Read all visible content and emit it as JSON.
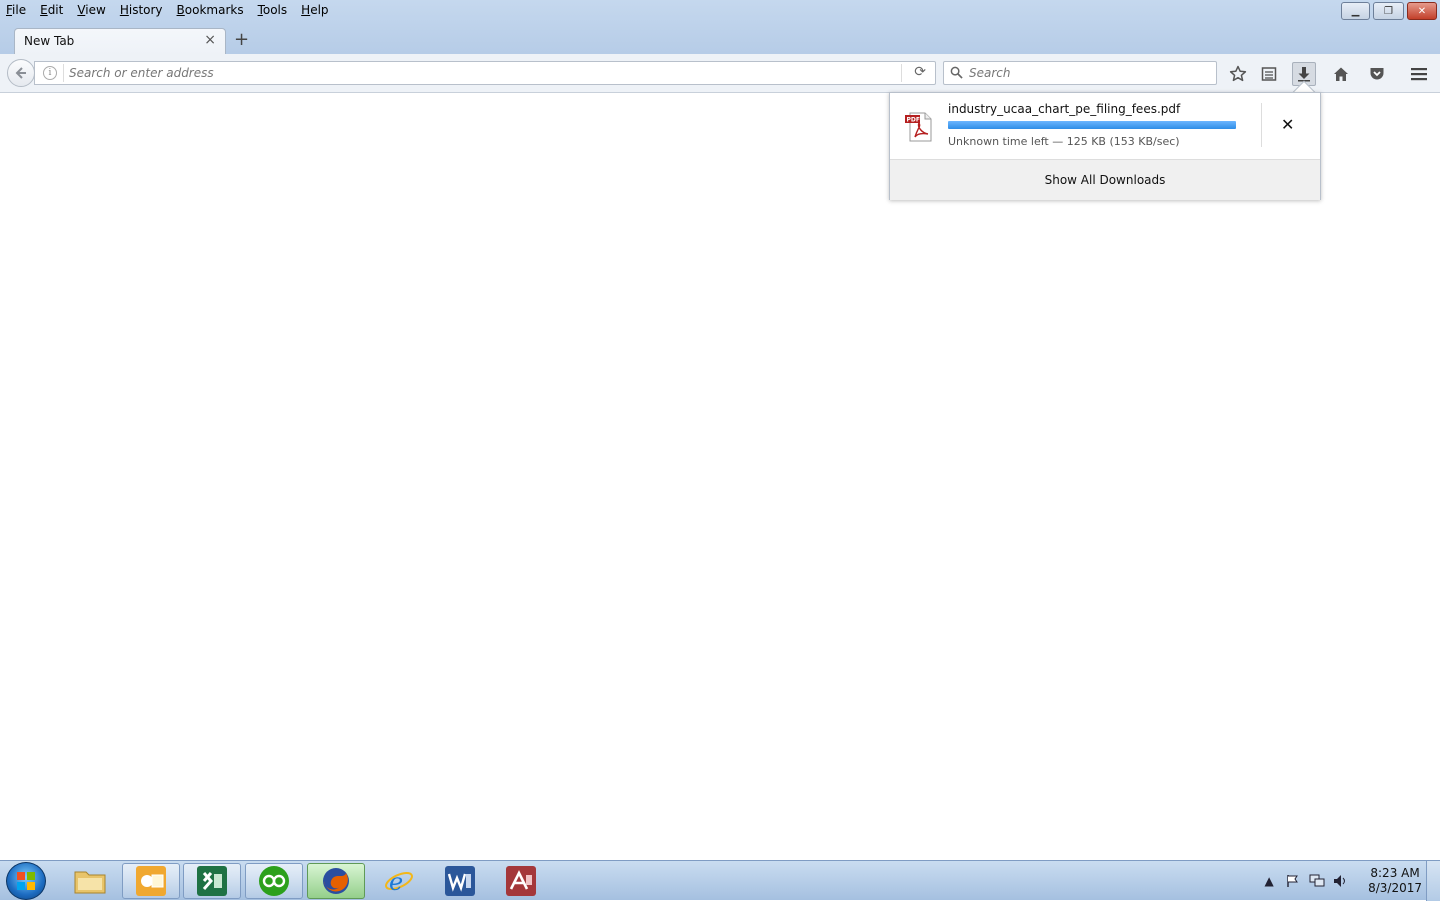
{
  "menubar": {
    "items": [
      "File",
      "Edit",
      "View",
      "History",
      "Bookmarks",
      "Tools",
      "Help"
    ]
  },
  "window_controls": {
    "minimize_icon": "minimize-icon",
    "restore_icon": "restore-icon",
    "close_icon": "close-icon"
  },
  "tabs": [
    {
      "title": "New Tab",
      "active": true
    }
  ],
  "navbar": {
    "url_placeholder": "Search or enter address",
    "search_placeholder": "Search"
  },
  "downloads": {
    "filename": "industry_ucaa_chart_pe_filing_fees.pdf",
    "progress_fraction": 1.0,
    "status": "Unknown time left — 125 KB (153 KB/sec)",
    "show_all_label": "Show All Downloads",
    "file_icon": "pdf-icon",
    "file_icon_label": "PDF"
  },
  "taskbar": {
    "apps": [
      {
        "name": "file-explorer",
        "state": "normal"
      },
      {
        "name": "outlook",
        "state": "pinned"
      },
      {
        "name": "excel",
        "state": "pinned"
      },
      {
        "name": "quickbooks",
        "state": "pinned"
      },
      {
        "name": "firefox",
        "state": "active"
      },
      {
        "name": "internet-explorer",
        "state": "normal"
      },
      {
        "name": "word",
        "state": "normal"
      },
      {
        "name": "access",
        "state": "normal"
      }
    ],
    "clock_time": "8:23 AM",
    "clock_date": "8/3/2017"
  },
  "colors": {
    "progress": "#2e8de6",
    "firefox_orange": "#e66000",
    "excel_green": "#1f7244",
    "quickbooks_green": "#2ca01c",
    "word_blue": "#2b579a",
    "access_red": "#a4373a"
  }
}
